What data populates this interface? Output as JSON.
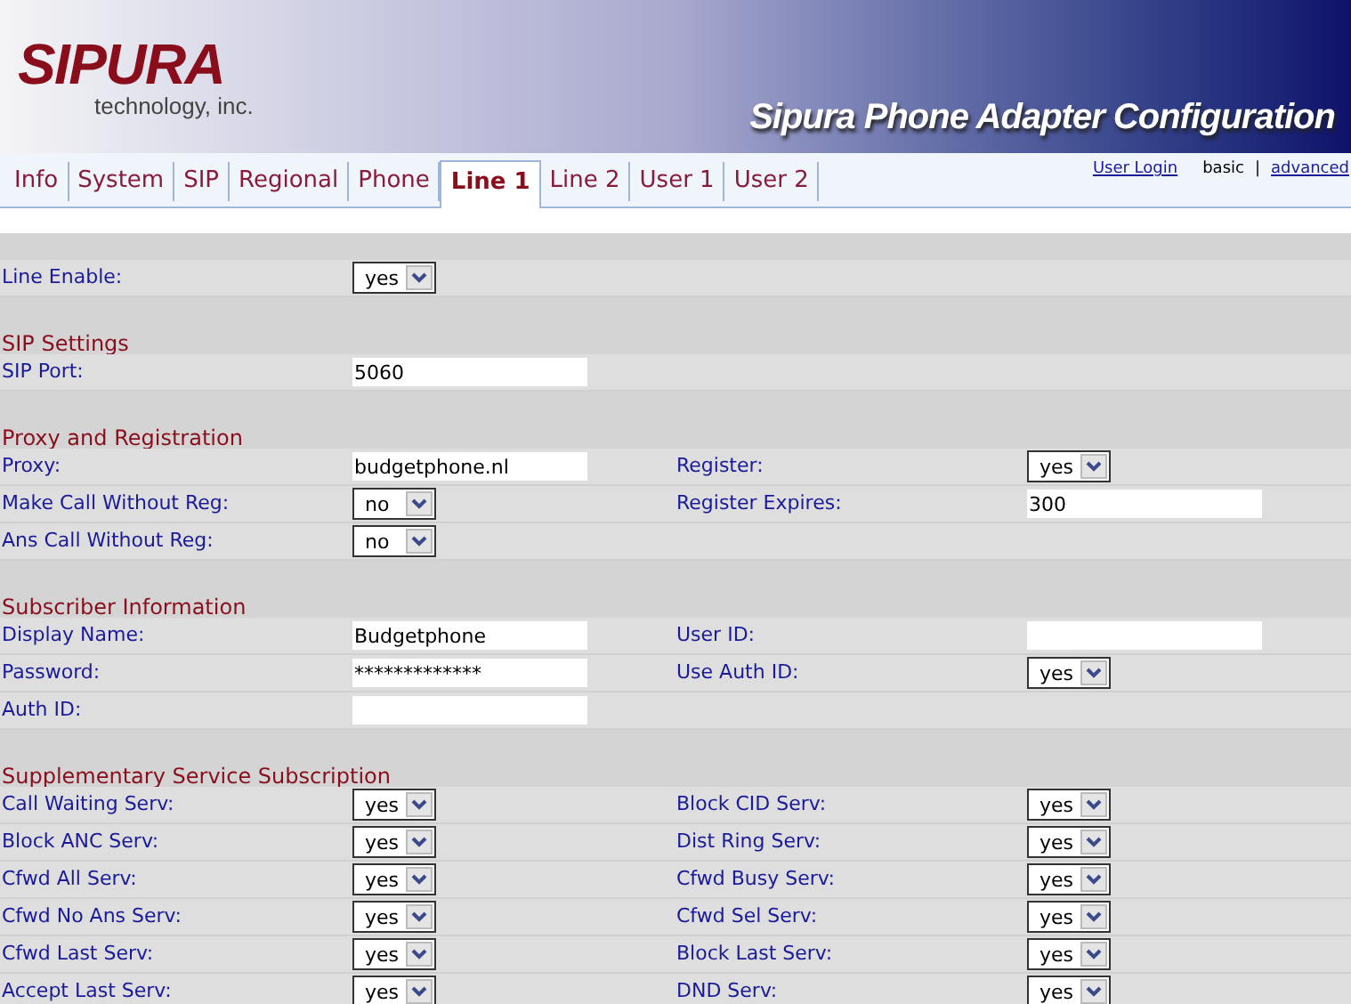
{
  "header": {
    "logo": "SIPURA",
    "logo_subtitle": "technology, inc.",
    "title": "Sipura Phone Adapter Configuration"
  },
  "tabs": [
    {
      "label": "Info",
      "selected": false
    },
    {
      "label": "System",
      "selected": false
    },
    {
      "label": "SIP",
      "selected": false
    },
    {
      "label": "Regional",
      "selected": false
    },
    {
      "label": "Phone",
      "selected": false
    },
    {
      "label": "Line 1",
      "selected": true
    },
    {
      "label": "Line 2",
      "selected": false
    },
    {
      "label": "User 1",
      "selected": false
    },
    {
      "label": "User 2",
      "selected": false
    }
  ],
  "account_links": {
    "login": "User Login",
    "modes": [
      {
        "label": "basic",
        "selected": true
      },
      {
        "label": "advanced",
        "selected": false
      }
    ],
    "separator": "|"
  },
  "sections": [
    {
      "rows": [
        {
          "left": {
            "label": "Line Enable:",
            "kind": "select",
            "value": "yes"
          }
        }
      ]
    },
    {
      "title": "SIP Settings",
      "rows": [
        {
          "left": {
            "label": "SIP Port:",
            "kind": "text",
            "value": "5060"
          }
        }
      ]
    },
    {
      "title": "Proxy and Registration",
      "rows": [
        {
          "left": {
            "label": "Proxy:",
            "kind": "text",
            "value": "budgetphone.nl"
          },
          "right": {
            "label": "Register:",
            "kind": "select",
            "value": "yes"
          }
        },
        {
          "left": {
            "label": "Make Call Without Reg:",
            "kind": "select",
            "value": "no"
          },
          "right": {
            "label": "Register Expires:",
            "kind": "text",
            "value": "300"
          }
        },
        {
          "left": {
            "label": "Ans Call Without Reg:",
            "kind": "select",
            "value": "no"
          }
        }
      ]
    },
    {
      "title": "Subscriber Information",
      "rows": [
        {
          "left": {
            "label": "Display Name:",
            "kind": "text",
            "value": "Budgetphone"
          },
          "right": {
            "label": "User ID:",
            "kind": "text"
          }
        },
        {
          "left": {
            "label": "Password:",
            "kind": "text",
            "value": "*************"
          },
          "right": {
            "label": "Use Auth ID:",
            "kind": "select",
            "value": "yes"
          }
        },
        {
          "left": {
            "label": "Auth ID:",
            "kind": "text"
          }
        }
      ]
    },
    {
      "title": "Supplementary Service Subscription",
      "rows": [
        {
          "left": {
            "label": "Call Waiting Serv:",
            "kind": "select",
            "value": "yes"
          },
          "right": {
            "label": "Block CID Serv:",
            "kind": "select",
            "value": "yes"
          }
        },
        {
          "left": {
            "label": "Block ANC Serv:",
            "kind": "select",
            "value": "yes"
          },
          "right": {
            "label": "Dist Ring Serv:",
            "kind": "select",
            "value": "yes"
          }
        },
        {
          "left": {
            "label": "Cfwd All Serv:",
            "kind": "select",
            "value": "yes"
          },
          "right": {
            "label": "Cfwd Busy Serv:",
            "kind": "select",
            "value": "yes"
          }
        },
        {
          "left": {
            "label": "Cfwd No Ans Serv:",
            "kind": "select",
            "value": "yes"
          },
          "right": {
            "label": "Cfwd Sel Serv:",
            "kind": "select",
            "value": "yes"
          }
        },
        {
          "left": {
            "label": "Cfwd Last Serv:",
            "kind": "select",
            "value": "yes"
          },
          "right": {
            "label": "Block Last Serv:",
            "kind": "select",
            "value": "yes"
          }
        },
        {
          "left": {
            "label": "Accept Last Serv:",
            "kind": "select",
            "value": "yes"
          },
          "right": {
            "label": "DND Serv:",
            "kind": "select",
            "value": "yes"
          }
        }
      ]
    }
  ]
}
